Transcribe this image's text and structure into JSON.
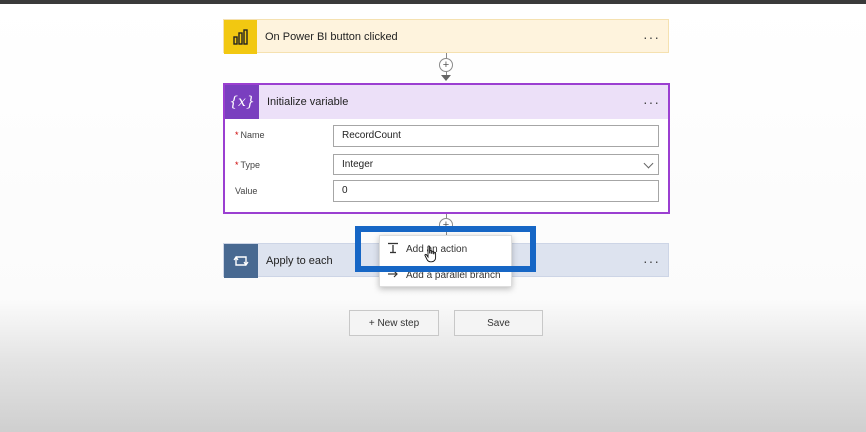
{
  "trigger": {
    "title": "On Power BI button clicked",
    "icon": "power-bi-icon",
    "more": "···"
  },
  "init_variable": {
    "title": "Initialize variable",
    "icon": "variable-icon",
    "icon_glyph": "{x}",
    "more": "···",
    "fields": {
      "name": {
        "label": "Name",
        "value": "RecordCount"
      },
      "type": {
        "label": "Type",
        "value": "Integer"
      },
      "value": {
        "label": "Value",
        "value": "0"
      }
    }
  },
  "apply_each": {
    "title": "Apply to each",
    "icon": "loop-icon",
    "more": "···"
  },
  "menu": {
    "add_action": "Add an action",
    "add_parallel": "Add a parallel branch"
  },
  "buttons": {
    "new_step": "+ New step",
    "save": "Save"
  },
  "colors": {
    "trigger_accent": "#f2c811",
    "variable_accent": "#7a3fbf",
    "apply_accent": "#486991",
    "highlight": "#1666c5"
  }
}
